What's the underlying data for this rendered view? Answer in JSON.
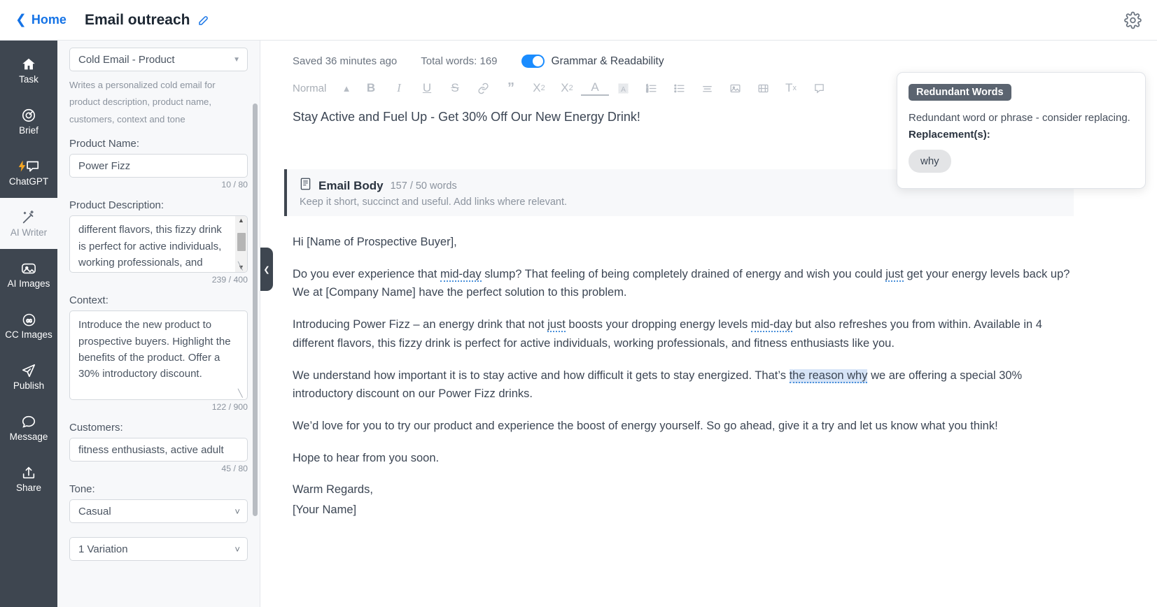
{
  "header": {
    "back_label": "Home",
    "title": "Email outreach",
    "edit_icon": "edit-pencil-icon",
    "gear_icon": "gear-icon",
    "accent_color": "#1573e6"
  },
  "sidebar": {
    "background": "#3e4650",
    "items": [
      {
        "label": "Task",
        "icon": "home-icon",
        "active": false
      },
      {
        "label": "Brief",
        "icon": "target-icon",
        "active": false
      },
      {
        "label": "ChatGPT",
        "icon": "chat-bolt-icon",
        "active": false
      },
      {
        "label": "AI Writer",
        "icon": "magic-wand-icon",
        "active": true
      },
      {
        "label": "AI Images",
        "icon": "image-icon",
        "active": false
      },
      {
        "label": "CC Images",
        "icon": "creative-commons-icon",
        "active": false
      },
      {
        "label": "Publish",
        "icon": "paper-plane-icon",
        "active": false
      },
      {
        "label": "Message",
        "icon": "speech-bubble-icon",
        "active": false
      },
      {
        "label": "Share",
        "icon": "share-upload-icon",
        "active": false
      }
    ]
  },
  "form": {
    "template_select": {
      "value": "Cold Email - Product",
      "caret": "triangle-down-icon"
    },
    "template_help": "Writes a personalized cold email for product description, product name, customers, context and tone",
    "product_name": {
      "label": "Product Name:",
      "value": "Power Fizz",
      "counter": "10 / 80"
    },
    "product_description": {
      "label": "Product Description:",
      "value": "different flavors, this fizzy drink is perfect for active individuals, working professionals, and fitness",
      "counter": "239 / 400"
    },
    "context": {
      "label": "Context:",
      "value": "Introduce the new product to prospective buyers. Highlight the benefits of the product. Offer a 30% introductory discount.",
      "counter": "122 / 900"
    },
    "customers": {
      "label": "Customers:",
      "value": "fitness enthusiasts, active adult",
      "counter": "45 / 80"
    },
    "tone": {
      "label": "Tone:",
      "value": "Casual",
      "caret": "chevron-down-icon"
    },
    "variation": {
      "value": "1 Variation",
      "caret": "chevron-down-icon"
    }
  },
  "collapse_handle": {
    "icon": "chevron-left-icon"
  },
  "editor": {
    "saved_status": "Saved 36 minutes ago",
    "total_words": "Total words: 169",
    "grammar_toggle_label": "Grammar & Readability",
    "grammar_toggle_on": true,
    "toggle_color": "#1a8cff",
    "toolbar": [
      {
        "label": "Normal",
        "icon": "paragraph-style-select"
      },
      {
        "label": "↕",
        "icon": "updown-arrows-icon"
      },
      {
        "label": "B",
        "icon": "bold-icon"
      },
      {
        "label": "I",
        "icon": "italic-icon"
      },
      {
        "label": "U",
        "icon": "underline-icon"
      },
      {
        "label": "S",
        "icon": "strikethrough-icon"
      },
      {
        "label": "🔗",
        "icon": "link-icon"
      },
      {
        "label": "”",
        "icon": "blockquote-icon"
      },
      {
        "label": "X₂",
        "icon": "subscript-icon"
      },
      {
        "label": "X²",
        "icon": "superscript-icon"
      },
      {
        "label": "A",
        "icon": "text-color-icon"
      },
      {
        "label": "▒",
        "icon": "highlight-color-icon"
      },
      {
        "label": "≣",
        "icon": "ordered-list-icon"
      },
      {
        "label": "☰",
        "icon": "bullet-list-icon"
      },
      {
        "label": "≡",
        "icon": "align-icon"
      },
      {
        "label": "▣",
        "icon": "insert-image-icon"
      },
      {
        "label": "▤",
        "icon": "insert-video-icon"
      },
      {
        "label": "Tx",
        "icon": "clear-formatting-icon"
      },
      {
        "label": "⬚",
        "icon": "comment-icon"
      }
    ],
    "subject": "Stay Active and Fuel Up - Get 30% Off Our New Energy Drink!",
    "section": {
      "icon": "document-icon",
      "title": "Email Body",
      "word_count": "157 / 50 words",
      "subtitle": "Keep it short, succinct and useful. Add links where relevant."
    },
    "paragraphs": [
      {
        "id": "greeting",
        "segments": [
          {
            "t": "Hi [Name of Prospective Buyer],"
          }
        ]
      },
      {
        "id": "p1",
        "segments": [
          {
            "t": "Do you ever experience that "
          },
          {
            "t": "mid-day",
            "style": "dotted"
          },
          {
            "t": " slump? That feeling of being completely drained of energy and wish you could "
          },
          {
            "t": "just",
            "style": "dotted"
          },
          {
            "t": " get your energy levels back up? We at [Company Name] have the perfect solution to this problem."
          }
        ]
      },
      {
        "id": "p2",
        "segments": [
          {
            "t": "Introducing Power Fizz – an energy drink that not "
          },
          {
            "t": "just",
            "style": "dotted"
          },
          {
            "t": " boosts your dropping energy levels "
          },
          {
            "t": "mid-day",
            "style": "dotted"
          },
          {
            "t": " but also refreshes you from within. Available in 4 different flavors, this fizzy drink is perfect for active individuals, working professionals, and fitness enthusiasts like you."
          }
        ]
      },
      {
        "id": "p3",
        "segments": [
          {
            "t": "We understand how important it is to stay active and how difficult it gets to stay energized. That’s "
          },
          {
            "t": "the reason why",
            "style": "highlight-dotted"
          },
          {
            "t": " we are offering a special 30% introductory discount on our Power Fizz drinks."
          }
        ]
      },
      {
        "id": "p4",
        "segments": [
          {
            "t": "We’d love for you to try our product and experience the boost of energy yourself. So go ahead, give it a try and let us know what you think!"
          }
        ]
      },
      {
        "id": "p5",
        "segments": [
          {
            "t": "Hope to hear from you soon."
          }
        ]
      },
      {
        "id": "p6",
        "segments": [
          {
            "t": "Warm Regards,"
          }
        ]
      },
      {
        "id": "p7",
        "segments": [
          {
            "t": "[Your Name]"
          }
        ]
      }
    ]
  },
  "popup": {
    "badge": "Redundant Words",
    "description": "Redundant word or phrase - consider replacing.",
    "replacement_label": "Replacement(s):",
    "replacements": [
      "why"
    ],
    "badge_color": "#5b6470"
  }
}
